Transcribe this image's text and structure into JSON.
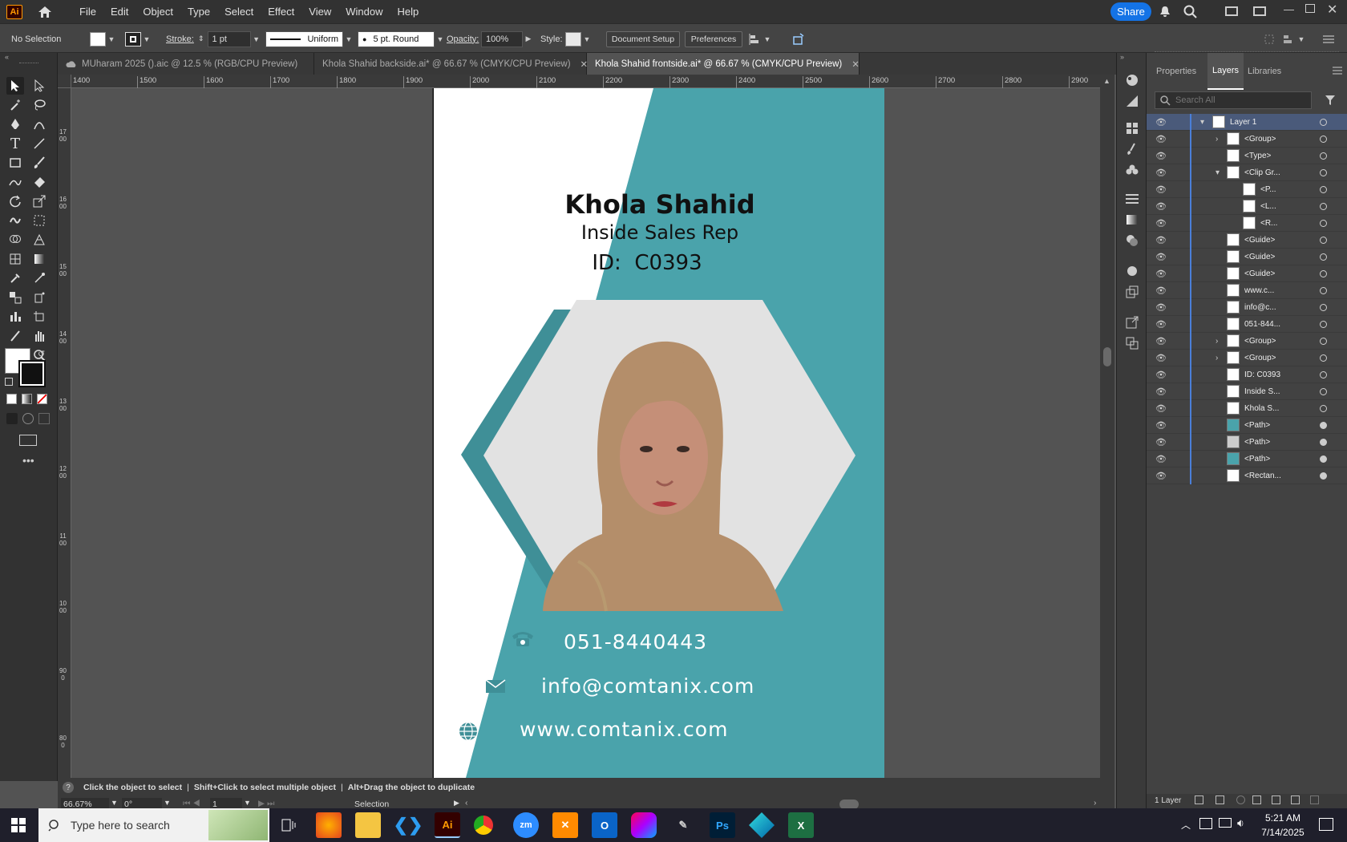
{
  "app": {
    "logo": "Ai",
    "menu": [
      "File",
      "Edit",
      "Object",
      "Type",
      "Select",
      "Effect",
      "View",
      "Window",
      "Help"
    ],
    "share": "Share"
  },
  "control": {
    "selection": "No Selection",
    "stroke_label": "Stroke:",
    "stroke_value": "1 pt",
    "profile": "Uniform",
    "brush": "5 pt. Round",
    "opacity_label": "Opacity:",
    "opacity_value": "100%",
    "style_label": "Style:",
    "doc_setup": "Document Setup",
    "preferences": "Preferences"
  },
  "tabs": [
    {
      "label": "MUharam 2025 ().aic @ 12.5 % (RGB/CPU Preview)"
    },
    {
      "label": "Khola Shahid backside.ai* @ 66.67 % (CMYK/CPU Preview)"
    },
    {
      "label": "Khola Shahid frontside.ai* @ 66.67 % (CMYK/CPU Preview)"
    }
  ],
  "ruler": {
    "h": [
      "1400",
      "1500",
      "1600",
      "1700",
      "1800",
      "1900",
      "2000",
      "2100",
      "2200",
      "2300",
      "2400",
      "2500",
      "2600",
      "2700",
      "2800",
      "2900"
    ],
    "v": [
      "1700",
      "1600",
      "1500",
      "1400",
      "1300",
      "1200",
      "1100",
      "1000",
      "900",
      "800"
    ]
  },
  "card": {
    "name": "Khola Shahid",
    "title": "Inside Sales Rep",
    "id": "ID:  C0393",
    "phone": "051-8440443",
    "email": "info@comtanix.com",
    "web": "www.comtanix.com",
    "teal": "#4aa3ab",
    "teal_dark": "#3f8f97"
  },
  "status": {
    "tip1": "Click the object to select",
    "tip2": "Shift+Click to select multiple object",
    "tip3": "Alt+Drag the object to duplicate",
    "zoom": "66.67%",
    "rotate": "0°",
    "artboard": "1",
    "tool": "Selection"
  },
  "panel": {
    "tabs": [
      "Properties",
      "Layers",
      "Libraries"
    ],
    "search_placeholder": "Search All",
    "footer": "1 Layer",
    "layers": [
      {
        "name": "Layer 1"
      },
      {
        "name": "<Group>"
      },
      {
        "name": "<Type>"
      },
      {
        "name": "<Clip Gr..."
      },
      {
        "name": "<P..."
      },
      {
        "name": "<L..."
      },
      {
        "name": "<R..."
      },
      {
        "name": "<Guide>"
      },
      {
        "name": "<Guide>"
      },
      {
        "name": "<Guide>"
      },
      {
        "name": "www.c..."
      },
      {
        "name": "info@c..."
      },
      {
        "name": "051-844..."
      },
      {
        "name": "<Group>"
      },
      {
        "name": "<Group>"
      },
      {
        "name": "ID:  C0393"
      },
      {
        "name": "Inside S..."
      },
      {
        "name": "Khola S..."
      },
      {
        "name": "<Path>"
      },
      {
        "name": "<Path>"
      },
      {
        "name": "<Path>"
      },
      {
        "name": "<Rectan..."
      }
    ]
  },
  "taskbar": {
    "search": "Type here to search",
    "time": "5:21 AM",
    "date": "7/14/2025"
  }
}
